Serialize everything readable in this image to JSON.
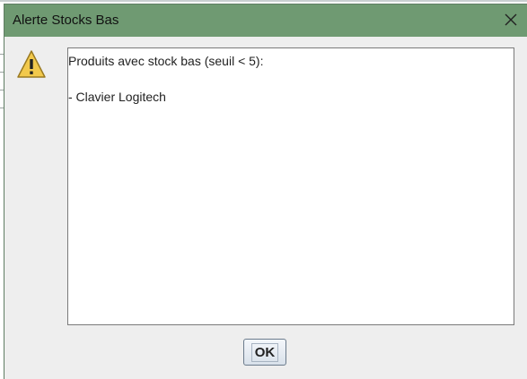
{
  "dialog": {
    "title": "Alerte Stocks Bas",
    "close_icon": "close-icon",
    "warning_icon": "warning-icon",
    "message_lines": [
      "Produits avec stock bas (seuil < 5):",
      "",
      "- Clavier Logitech"
    ],
    "ok_label": "OK"
  },
  "colors": {
    "titlebar": "#6f9a72",
    "dialog_bg": "#eeeeee",
    "warning_fill": "#f2c94c"
  }
}
